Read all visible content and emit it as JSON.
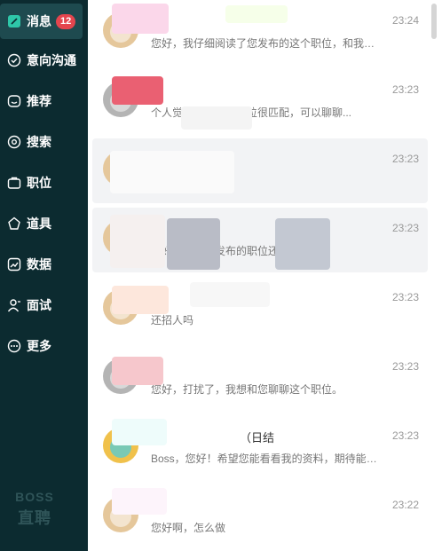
{
  "sidebar": {
    "items": [
      {
        "label": "消息",
        "icon": "chat-icon",
        "badge": "12",
        "active": true
      },
      {
        "label": "意向沟通",
        "icon": "check-circle-icon"
      },
      {
        "label": "推荐",
        "icon": "smile-face-icon"
      },
      {
        "label": "搜索",
        "icon": "search-icon"
      },
      {
        "label": "职位",
        "icon": "briefcase-icon"
      },
      {
        "label": "道具",
        "icon": "star-icon"
      },
      {
        "label": "数据",
        "icon": "chart-icon"
      },
      {
        "label": "面试",
        "icon": "user-icon"
      },
      {
        "label": "更多",
        "icon": "more-dots-icon"
      }
    ],
    "brand_top": "BOSS",
    "brand_bottom": "直聘"
  },
  "conversations": [
    {
      "name": "",
      "preview": "您好，我仔细阅读了您发布的这个职位，和我自...",
      "time": "23:24"
    },
    {
      "name": "",
      "preview": "个人觉得我与这一岗位很匹配，可以聊聊...",
      "time": "23:23"
    },
    {
      "name": "",
      "preview": "",
      "time": "23:23"
    },
    {
      "name": "",
      "preview": "您好，我对您发布的职位还...",
      "time": "23:23"
    },
    {
      "name": "",
      "preview": "还招人吗",
      "time": "23:23"
    },
    {
      "name": "",
      "preview": "您好，打扰了，我想和您聊聊这个职位。",
      "time": "23:23"
    },
    {
      "name": "（日结",
      "preview": "Boss，您好！希望您能看看我的资料，期待能有...",
      "time": "23:23"
    },
    {
      "name": "",
      "preview": "您好啊，怎么做",
      "time": "23:22"
    }
  ],
  "colors": {
    "sidebar_bg": "#0c2b30",
    "sidebar_active": "#1e4a4f",
    "badge": "#e4454e"
  }
}
